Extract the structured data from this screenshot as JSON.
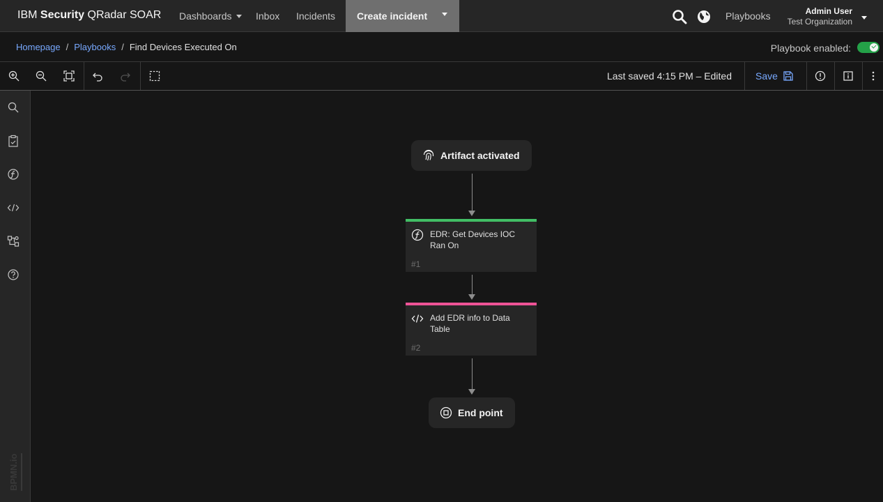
{
  "header": {
    "brand_prefix": "IBM",
    "brand_bold": "Security",
    "brand_suffix": "QRadar SOAR",
    "nav": {
      "dashboards": "Dashboards",
      "inbox": "Inbox",
      "incidents": "Incidents"
    },
    "create_incident": "Create incident",
    "playbooks": "Playbooks",
    "user_name": "Admin User",
    "org_name": "Test Organization"
  },
  "breadcrumb": {
    "home": "Homepage",
    "playbooks": "Playbooks",
    "current": "Find Devices Executed On"
  },
  "playbook_enabled": {
    "label": "Playbook enabled:",
    "value": true
  },
  "toolbar": {
    "last_saved": "Last saved 4:15 PM – Edited",
    "save_label": "Save"
  },
  "workflow": {
    "start": {
      "label": "Artifact activated",
      "icon": "fingerprint-icon"
    },
    "tasks": [
      {
        "label": "EDR: Get Devices IOC Ran On",
        "number": "#1",
        "icon": "function-icon",
        "accent": "#42be65"
      },
      {
        "label": "Add EDR info to Data Table",
        "number": "#2",
        "icon": "code-icon",
        "accent": "#ee5396"
      }
    ],
    "end": {
      "label": "End point",
      "icon": "stop-icon"
    }
  },
  "watermark": "BPMN.io",
  "colors": {
    "link": "#78a9ff",
    "toggle_on": "#24a148",
    "function_accent": "#42be65",
    "script_accent": "#ee5396"
  }
}
